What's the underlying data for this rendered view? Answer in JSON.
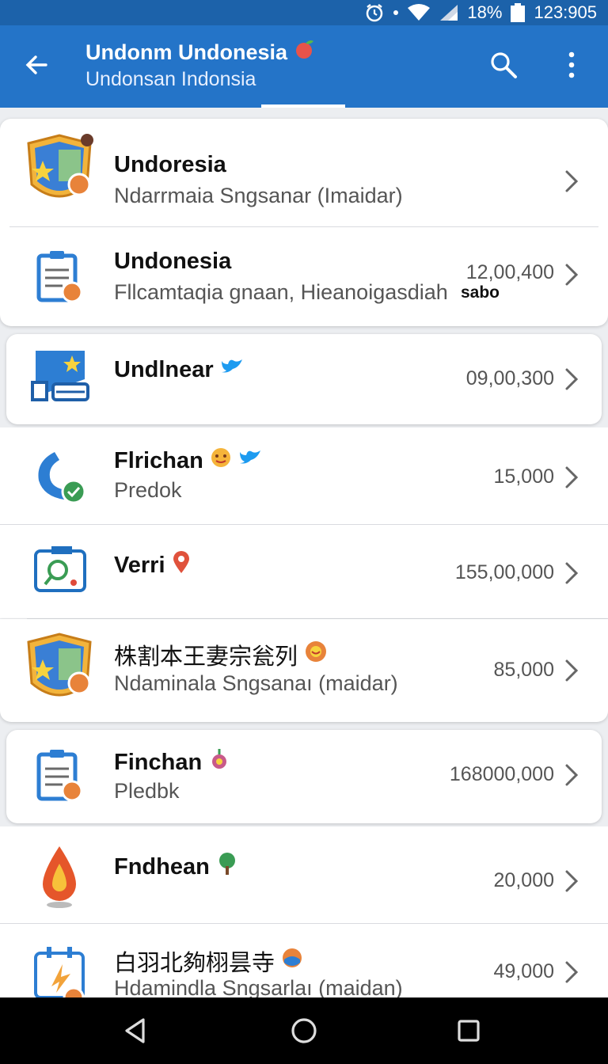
{
  "status_bar": {
    "battery": "18%",
    "time": "123:905",
    "icons": [
      "alarm-icon",
      "wifi-icon",
      "signal-icon",
      "battery-icon"
    ]
  },
  "app_bar": {
    "title": "Undonm Undonesia",
    "subtitle": "Undonsan Indonsia",
    "colors": {
      "bar": "#2474c8",
      "status": "#1c62aa"
    }
  },
  "list": {
    "items": [
      {
        "name": "Undoresia",
        "description": "Ndarrmaia Sngsanar (Imaidar)",
        "value": "",
        "icon": "shield-icon"
      },
      {
        "name": "Undonesia",
        "description": "Fllcamtaqia gnaan, Hieanoigasdiah",
        "value": "12,00,400",
        "extra": "sabo",
        "icon": "document-icon"
      },
      {
        "name": "Undlnear",
        "description": "",
        "value": "09,00,300",
        "icon": "id-card-icon"
      },
      {
        "name": "Flrichan",
        "description": "Predok",
        "value": "15,000",
        "icon": "phone-icon"
      },
      {
        "name": "Verri",
        "description": "",
        "value": "155,00,000",
        "icon": "map-search-icon"
      },
      {
        "name": "株割本王妻宗瓮列",
        "description": "Ndaminala Sngsanaı (maidar)",
        "value": "85,000",
        "icon": "shield-icon"
      },
      {
        "name": "Finchan",
        "description": "Pledbk",
        "value": "168000,000",
        "icon": "document-icon"
      },
      {
        "name": "Fndhean",
        "description": "",
        "value": "20,000",
        "icon": "droplet-icon"
      },
      {
        "name": "白羽北夠栩昙寺",
        "description": "Hdamindla Sngsarlaı (maidan)",
        "value": "49,000",
        "icon": "calendar-icon"
      }
    ]
  }
}
